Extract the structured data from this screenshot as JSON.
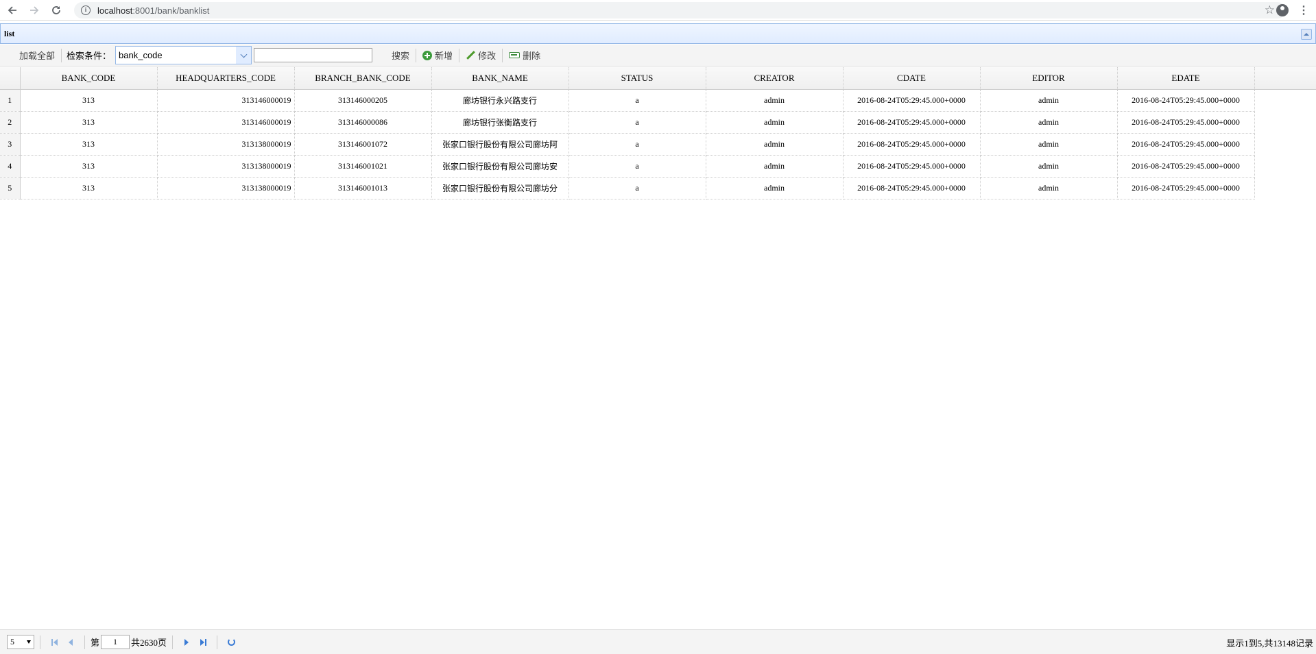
{
  "browser": {
    "url_host": "localhost",
    "url_path": ":8001/bank/banklist"
  },
  "panel": {
    "title": "list"
  },
  "toolbar": {
    "load_all": "加载全部",
    "search_condition_label": "检索条件：",
    "search_field_value": "bank_code",
    "search_input_value": "",
    "search_button": "搜索",
    "add_button": "新增",
    "edit_button": "修改",
    "delete_button": "删除"
  },
  "grid": {
    "columns": [
      "BANK_CODE",
      "HEADQUARTERS_CODE",
      "BRANCH_BANK_CODE",
      "BANK_NAME",
      "STATUS",
      "CREATOR",
      "CDATE",
      "EDITOR",
      "EDATE"
    ],
    "rows": [
      {
        "rn": "1",
        "bank_code": "313",
        "headquarters_code": "313146000019",
        "branch_bank_code": "313146000205",
        "bank_name": "廊坊银行永兴路支行",
        "status": "a",
        "creator": "admin",
        "cdate": "2016-08-24T05:29:45.000+0000",
        "editor": "admin",
        "edate": "2016-08-24T05:29:45.000+0000"
      },
      {
        "rn": "2",
        "bank_code": "313",
        "headquarters_code": "313146000019",
        "branch_bank_code": "313146000086",
        "bank_name": "廊坊银行张衡路支行",
        "status": "a",
        "creator": "admin",
        "cdate": "2016-08-24T05:29:45.000+0000",
        "editor": "admin",
        "edate": "2016-08-24T05:29:45.000+0000"
      },
      {
        "rn": "3",
        "bank_code": "313",
        "headquarters_code": "313138000019",
        "branch_bank_code": "313146001072",
        "bank_name": "张家口银行股份有限公司廊坊阿",
        "status": "a",
        "creator": "admin",
        "cdate": "2016-08-24T05:29:45.000+0000",
        "editor": "admin",
        "edate": "2016-08-24T05:29:45.000+0000"
      },
      {
        "rn": "4",
        "bank_code": "313",
        "headquarters_code": "313138000019",
        "branch_bank_code": "313146001021",
        "bank_name": "张家口银行股份有限公司廊坊安",
        "status": "a",
        "creator": "admin",
        "cdate": "2016-08-24T05:29:45.000+0000",
        "editor": "admin",
        "edate": "2016-08-24T05:29:45.000+0000"
      },
      {
        "rn": "5",
        "bank_code": "313",
        "headquarters_code": "313138000019",
        "branch_bank_code": "313146001013",
        "bank_name": "张家口银行股份有限公司廊坊分",
        "status": "a",
        "creator": "admin",
        "cdate": "2016-08-24T05:29:45.000+0000",
        "editor": "admin",
        "edate": "2016-08-24T05:29:45.000+0000"
      }
    ]
  },
  "pager": {
    "page_size": "5",
    "page_prefix": "第",
    "current_page": "1",
    "total_pages_text": "共2630页",
    "info": "显示1到5,共13148记录"
  }
}
